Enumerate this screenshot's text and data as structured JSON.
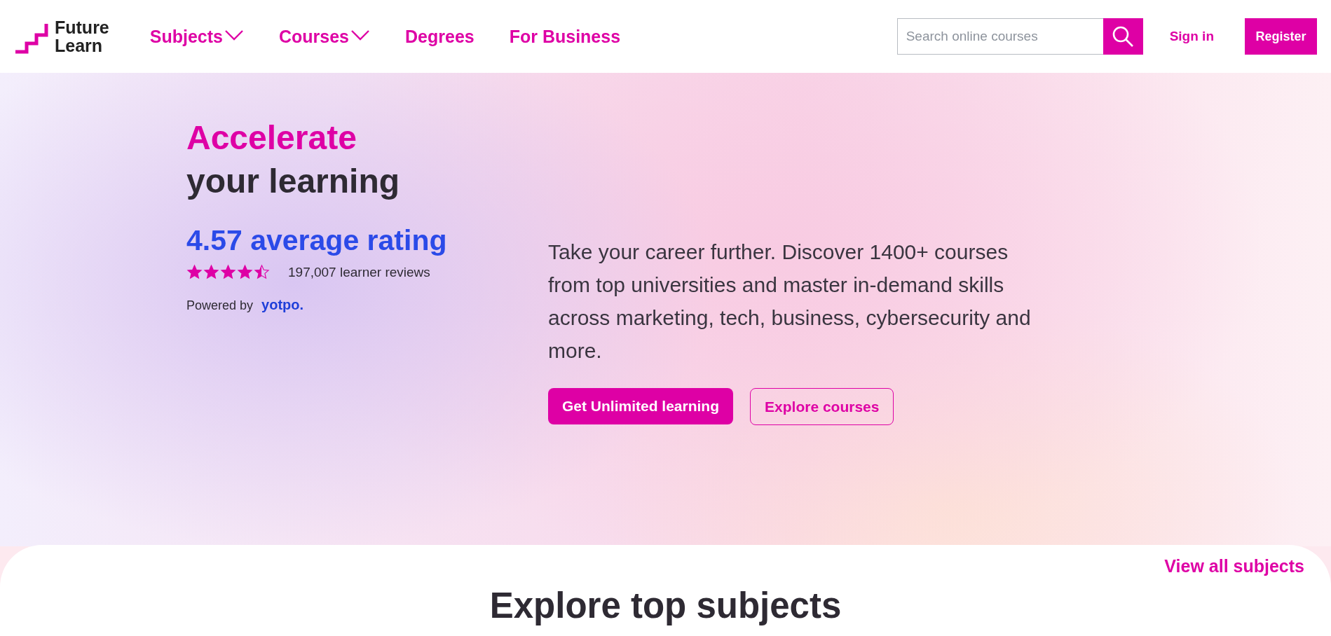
{
  "header": {
    "logo": [
      "Future",
      "Learn"
    ],
    "nav": [
      {
        "label": "Subjects",
        "dropdown": true
      },
      {
        "label": "Courses",
        "dropdown": true
      },
      {
        "label": "Degrees",
        "dropdown": false
      },
      {
        "label": "For Business",
        "dropdown": false
      }
    ],
    "search": {
      "placeholder": "Search online courses"
    },
    "sign_in": "Sign in",
    "register": "Register"
  },
  "hero": {
    "title_accent": "Accelerate",
    "title": "your learning",
    "rating": "4.57 average rating",
    "stars": 4.5,
    "reviews": "197,007 learner reviews",
    "powered_by": "Powered by",
    "provider": "yotpo.",
    "description": "Take your career further. Discover 1400+ courses from top universities and master in-demand skills across marketing, tech, business, cybersecurity and more.",
    "primary_button": "Get Unlimited learning",
    "secondary_button": "Explore courses"
  },
  "subjects": {
    "view_all": "View all subjects",
    "heading": "Explore top subjects"
  }
}
